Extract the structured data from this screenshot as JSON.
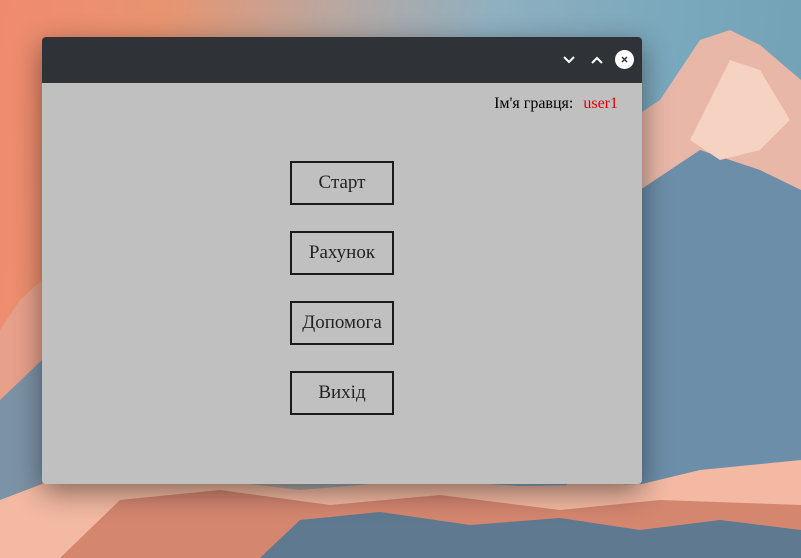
{
  "window": {
    "controls": {
      "minimize_icon": "chevron-down-icon",
      "maximize_icon": "chevron-up-icon",
      "close_icon": "close-icon"
    }
  },
  "header": {
    "player_label": "Ім'я гравця:",
    "player_name": "user1",
    "player_name_color": "#e00000"
  },
  "menu": {
    "start_label": "Старт",
    "score_label": "Рахунок",
    "help_label": "Допомога",
    "exit_label": "Вихід"
  },
  "colors": {
    "titlebar": "#2f3337",
    "window_bg": "#c0c0c0"
  }
}
